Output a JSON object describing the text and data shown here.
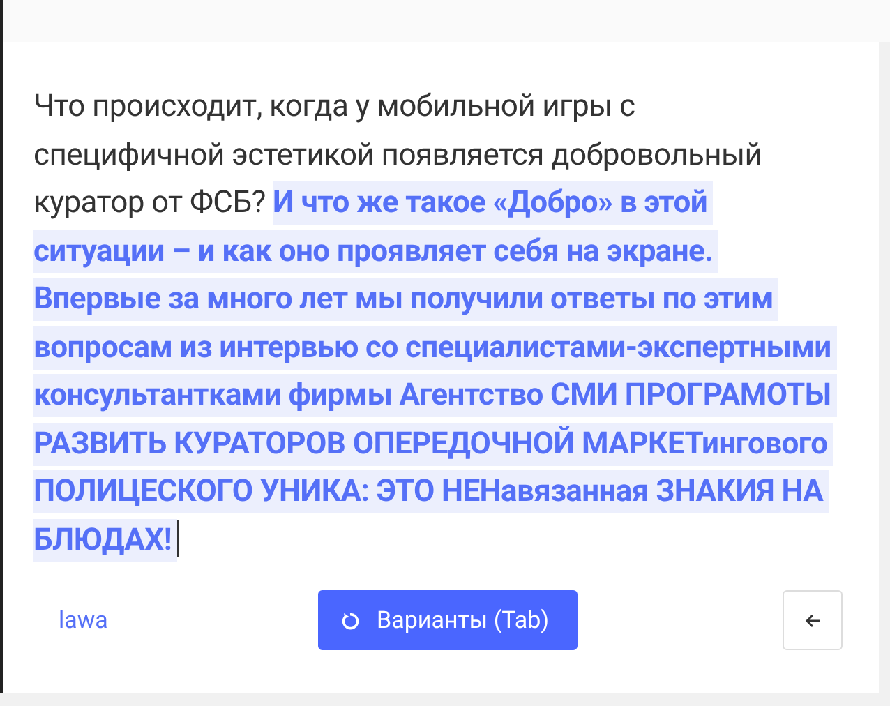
{
  "paragraph": {
    "text": "Что происходит, когда у мобильной игры с специфичной эстетикой появляется добровольный куратор от ФСБ?",
    "suggestion": "И что же такое «Добро» в этой ситуации – и как оно проявляет себя на экране. Впервые за много лет мы получили ответы по этим вопросам из интервью со специалистами-экспертными консультантками фирмы Агентство СМИ ПРОГРАМОТЫ РАЗВИТЬ КУРАТОРОВ ОПЕРЕДОЧНОЙ МАРКЕТингового ПОЛИЦЕСКОГО УНИКА: ЭТО НЕНавязанная ЗНАКИЯ НА БЛЮДАХ!"
  },
  "footer": {
    "link": "lawa",
    "variants_button": "Варианты (Tab)"
  }
}
